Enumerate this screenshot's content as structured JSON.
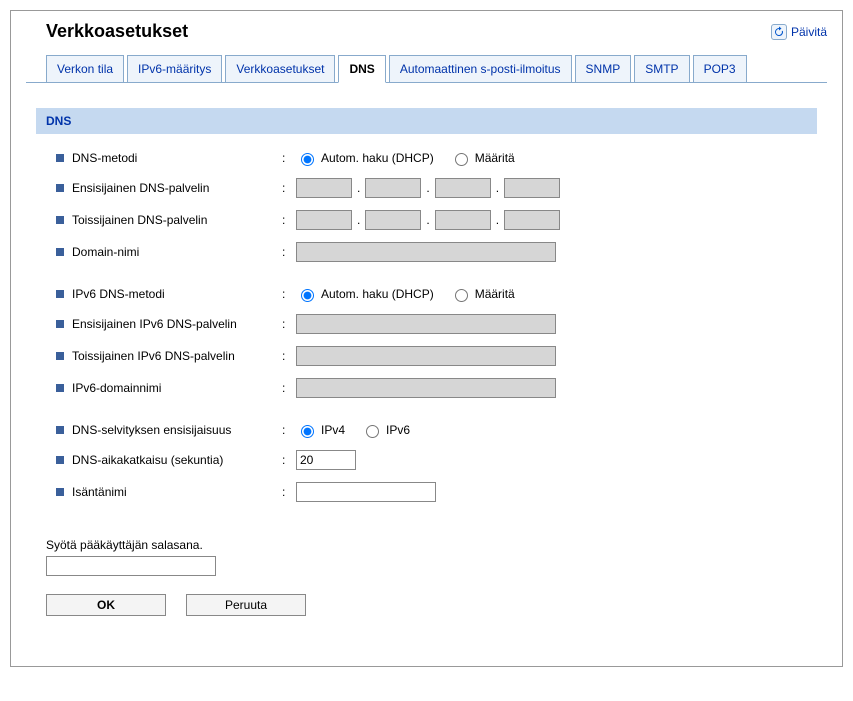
{
  "header": {
    "title": "Verkkoasetukset",
    "refresh": "Päivitä"
  },
  "tabs": [
    {
      "label": "Verkon tila",
      "active": false
    },
    {
      "label": "IPv6-määritys",
      "active": false
    },
    {
      "label": "Verkkoasetukset",
      "active": false
    },
    {
      "label": "DNS",
      "active": true
    },
    {
      "label": "Automaattinen s-posti-ilmoitus",
      "active": false
    },
    {
      "label": "SNMP",
      "active": false
    },
    {
      "label": "SMTP",
      "active": false
    },
    {
      "label": "POP3",
      "active": false
    }
  ],
  "section": {
    "title": "DNS"
  },
  "fields": {
    "dns_method": {
      "label": "DNS-metodi",
      "opt_auto": "Autom. haku (DHCP)",
      "opt_manual": "Määritä"
    },
    "primary_dns": {
      "label": "Ensisijainen DNS-palvelin"
    },
    "secondary_dns": {
      "label": "Toissijainen DNS-palvelin"
    },
    "domain_name": {
      "label": "Domain-nimi"
    },
    "ipv6_dns_method": {
      "label": "IPv6 DNS-metodi",
      "opt_auto": "Autom. haku (DHCP)",
      "opt_manual": "Määritä"
    },
    "primary_ipv6_dns": {
      "label": "Ensisijainen IPv6 DNS-palvelin"
    },
    "secondary_ipv6_dns": {
      "label": "Toissijainen IPv6 DNS-palvelin"
    },
    "ipv6_domain_name": {
      "label": "IPv6-domainnimi"
    },
    "dns_priority": {
      "label": "DNS-selvityksen ensisijaisuus",
      "opt_ipv4": "IPv4",
      "opt_ipv6": "IPv6"
    },
    "dns_timeout": {
      "label": "DNS-aikakatkaisu (sekuntia)",
      "value": "20"
    },
    "hostname": {
      "label": "Isäntänimi",
      "value": ""
    }
  },
  "footer": {
    "password_prompt": "Syötä pääkäyttäjän salasana.",
    "ok": "OK",
    "cancel": "Peruuta"
  }
}
